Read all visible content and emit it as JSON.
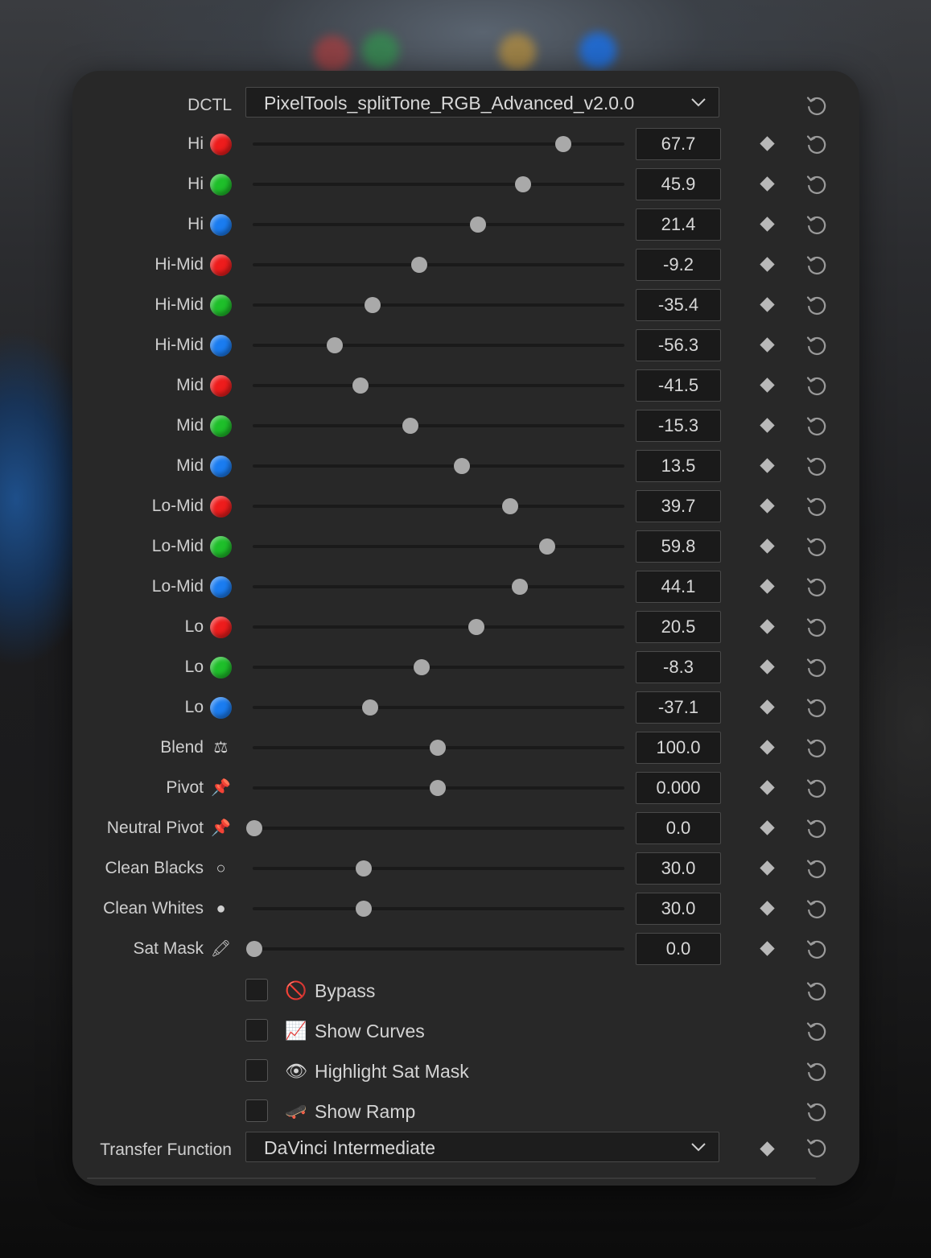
{
  "dctl": {
    "label": "DCTL",
    "selected": "PixelTools_splitTone_RGB_Advanced_v2.0.0"
  },
  "sliders": [
    {
      "label": "Hi",
      "marker": "red-dot",
      "value": "67.7",
      "level": 0.835
    },
    {
      "label": "Hi",
      "marker": "green-dot",
      "value": "45.9",
      "level": 0.727
    },
    {
      "label": "Hi",
      "marker": "blue-dot",
      "value": "21.4",
      "level": 0.606
    },
    {
      "label": "Hi-Mid",
      "marker": "red-dot",
      "value": "-9.2",
      "level": 0.449
    },
    {
      "label": "Hi-Mid",
      "marker": "green-dot",
      "value": "-35.4",
      "level": 0.323
    },
    {
      "label": "Hi-Mid",
      "marker": "blue-dot",
      "value": "-56.3",
      "level": 0.221
    },
    {
      "label": "Mid",
      "marker": "red-dot",
      "value": "-41.5",
      "level": 0.29
    },
    {
      "label": "Mid",
      "marker": "green-dot",
      "value": "-15.3",
      "level": 0.424
    },
    {
      "label": "Mid",
      "marker": "blue-dot",
      "value": "13.5",
      "level": 0.563
    },
    {
      "label": "Lo-Mid",
      "marker": "red-dot",
      "value": "39.7",
      "level": 0.693
    },
    {
      "label": "Lo-Mid",
      "marker": "green-dot",
      "value": "59.8",
      "level": 0.792
    },
    {
      "label": "Lo-Mid",
      "marker": "blue-dot",
      "value": "44.1",
      "level": 0.719
    },
    {
      "label": "Lo",
      "marker": "red-dot",
      "value": "20.5",
      "level": 0.602
    },
    {
      "label": "Lo",
      "marker": "green-dot",
      "value": "-8.3",
      "level": 0.455
    },
    {
      "label": "Lo",
      "marker": "blue-dot",
      "value": "-37.1",
      "level": 0.316
    },
    {
      "label": "Blend",
      "marker": "⚖",
      "value": "100.0",
      "level": 0.498
    },
    {
      "label": "Pivot",
      "marker": "📌",
      "value": "0.000",
      "level": 0.498
    },
    {
      "label": "Neutral Pivot",
      "marker": "📌",
      "value": "0.0",
      "level": 0.004
    },
    {
      "label": "Clean Blacks",
      "marker": "○",
      "value": "30.0",
      "level": 0.299
    },
    {
      "label": "Clean Whites",
      "marker": "●",
      "value": "30.0",
      "level": 0.299
    },
    {
      "label": "Sat Mask",
      "marker": "🖍",
      "value": "0.0",
      "level": 0.004
    }
  ],
  "checkboxes": [
    {
      "emoji": "🚫",
      "label": "Bypass",
      "checked": false
    },
    {
      "emoji": "📈",
      "label": "Show Curves",
      "checked": false
    },
    {
      "emoji": "👁",
      "label": "Highlight Sat Mask",
      "checked": false
    },
    {
      "emoji": "🛹",
      "label": "Show Ramp",
      "checked": false
    }
  ],
  "transfer": {
    "label": "Transfer Function",
    "selected": "DaVinci Intermediate"
  },
  "colors": {
    "red-dot": "#ee1c1c",
    "green-dot": "#1ebf2a",
    "blue-dot": "#1a7cf0",
    "panel": "#282828",
    "knob": "#a9a9a9"
  },
  "icons": {
    "reset": "reset-icon",
    "keyframe": "keyframe-diamond-icon",
    "dropdown": "chevron-down-icon"
  }
}
